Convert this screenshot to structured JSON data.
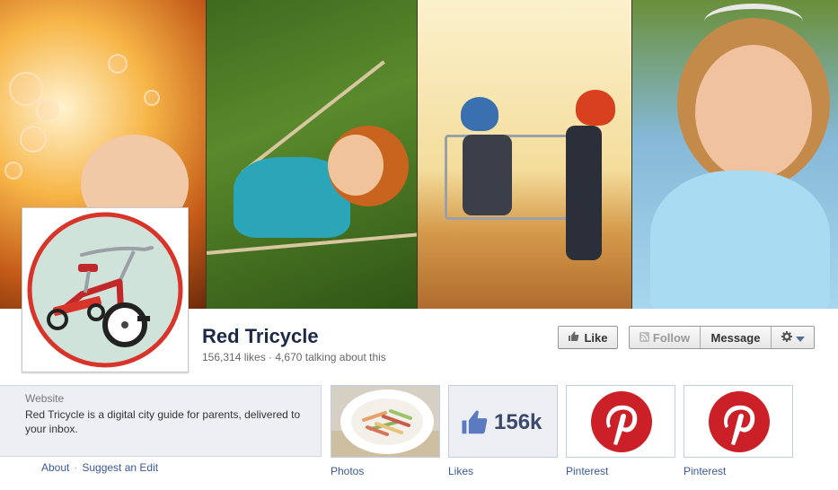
{
  "page": {
    "name": "Red Tricycle",
    "stats": "156,314 likes · 4,670 talking about this"
  },
  "actions": {
    "like": "Like",
    "follow": "Follow",
    "message": "Message"
  },
  "about": {
    "label": "Website",
    "text": "Red Tricycle is a digital city guide for parents, delivered to your inbox.",
    "links": {
      "about": "About",
      "separator": "·",
      "suggest": "Suggest an Edit"
    }
  },
  "apps": [
    {
      "label": "Photos"
    },
    {
      "label": "Likes",
      "count": "156k"
    },
    {
      "label": "Pinterest"
    },
    {
      "label": "Pinterest"
    }
  ],
  "colors": {
    "facebook_blue": "#3b5998",
    "pinterest_red": "#cb2027",
    "tricycle_red": "#d8342a",
    "logo_bg": "#cfe3da"
  },
  "icons": [
    "thumbs-up-icon",
    "rss-icon",
    "gear-icon",
    "chevron-down-icon",
    "pinterest-logo-icon",
    "tricycle-logo"
  ]
}
